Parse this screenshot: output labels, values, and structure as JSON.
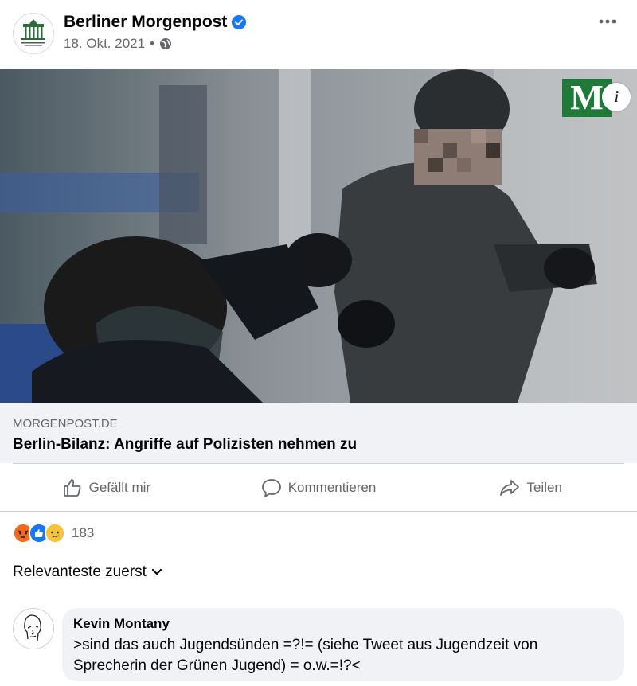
{
  "post": {
    "page_name": "Berliner Morgenpost",
    "date": "18. Okt. 2021",
    "separator": "•",
    "more_label": "•••"
  },
  "image": {
    "brand_letter": "M",
    "info_label": "i"
  },
  "link": {
    "domain": "MORGENPOST.DE",
    "title": "Berlin-Bilanz: Angriffe auf Polizisten nehmen zu"
  },
  "actions": [
    {
      "label": "Gefällt mir",
      "icon": "thumbs-up-icon"
    },
    {
      "label": "Kommentieren",
      "icon": "comment-icon"
    },
    {
      "label": "Teilen",
      "icon": "share-icon"
    }
  ],
  "reactions": {
    "count": "183",
    "types": [
      "angry",
      "like",
      "sad"
    ]
  },
  "sort": {
    "label": "Relevanteste zuerst"
  },
  "comment": {
    "author": "Kevin Montany",
    "text": ">sind das auch Jugendsünden =?!= (siehe Tweet aus Jugendzeit von Sprecherin der Grünen Jugend) = o.w.=!?<"
  },
  "colors": {
    "brand_green": "#1f7a3a",
    "verified_blue": "#1877f2",
    "secondary_text": "#65676b",
    "link_bg": "#f0f2f5"
  }
}
